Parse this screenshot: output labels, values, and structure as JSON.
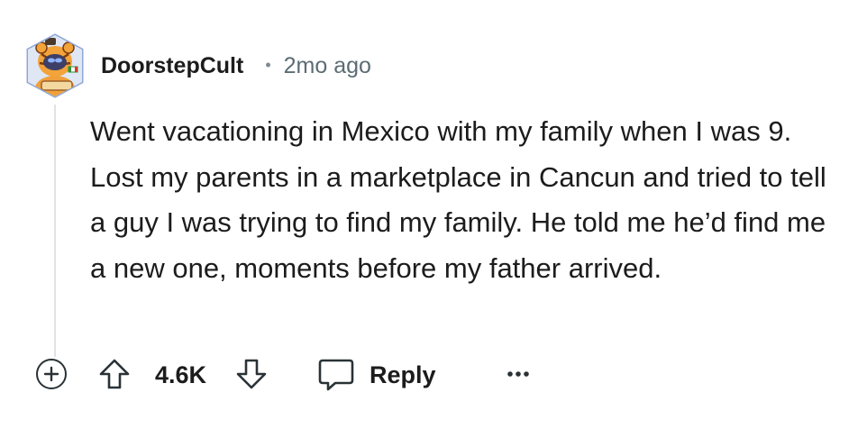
{
  "comment": {
    "author": "DoorstepCult",
    "separator": "•",
    "timestamp": "2mo ago",
    "text": "Went vacationing in Mexico with my family when I was 9. Lost my parents in a marketplace in Cancun and tried to tell a guy I was trying to find my family. He told me he’d find me a new one, moments before my father arrived.",
    "avatar_icon": "tiger-mascot-avatar"
  },
  "actions": {
    "expand_icon": "plus-circle-icon",
    "upvote_icon": "arrow-up-outline-icon",
    "score": "4.6K",
    "downvote_icon": "arrow-down-outline-icon",
    "reply_icon": "speech-bubble-icon",
    "reply_label": "Reply",
    "more_icon": "ellipsis-icon"
  },
  "colors": {
    "text": "#1c1c1c",
    "muted": "#5c6c74",
    "thread_line": "#dfe3e6",
    "avatar_ring": "#7c9bd6"
  }
}
